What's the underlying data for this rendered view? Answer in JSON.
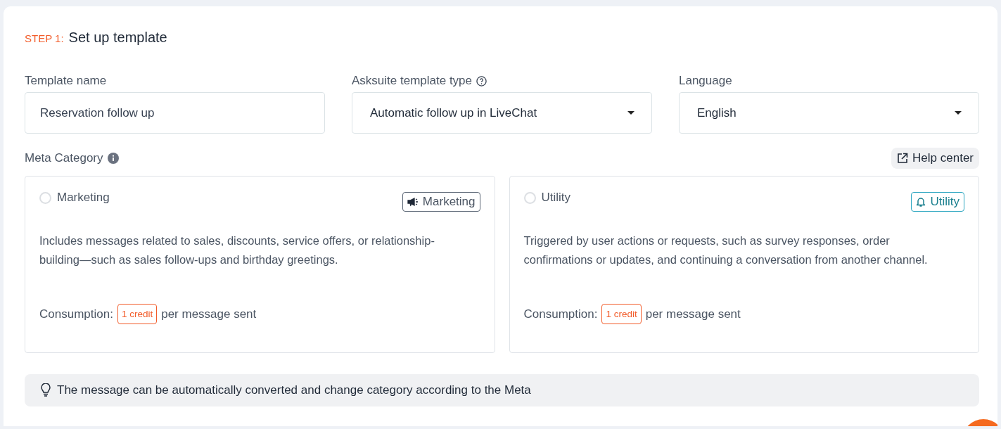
{
  "step": {
    "label": "STEP 1:",
    "title": "Set up template"
  },
  "fields": [
    {
      "kind": "text",
      "label": "Template name",
      "value": "Reservation follow up",
      "help": false
    },
    {
      "kind": "select",
      "label": "Asksuite template type",
      "value": "Automatic follow up in LiveChat",
      "help": true
    },
    {
      "kind": "select",
      "label": "Language",
      "value": "English",
      "help": false
    }
  ],
  "meta_category": {
    "label": "Meta Category",
    "help_link": "Help center"
  },
  "categories": [
    {
      "kind": "marketing",
      "name": "Marketing",
      "selected": false,
      "tag": "Marketing",
      "description": "Includes messages related to sales, discounts, service offers, or relationship-building—such as sales follow-ups and birthday greetings.",
      "consumption_label": "Consumption:",
      "credit": "1 credit",
      "consumption_suffix": "per message sent"
    },
    {
      "kind": "utility",
      "name": "Utility",
      "selected": false,
      "tag": "Utility",
      "description": "Triggered by user actions or requests, such as survey responses, order confirmations or updates, and continuing a conversation from another channel.",
      "consumption_label": "Consumption:",
      "credit": "1 credit",
      "consumption_suffix": "per message sent"
    }
  ],
  "note": "The message can be automatically converted and change category according to the Meta"
}
